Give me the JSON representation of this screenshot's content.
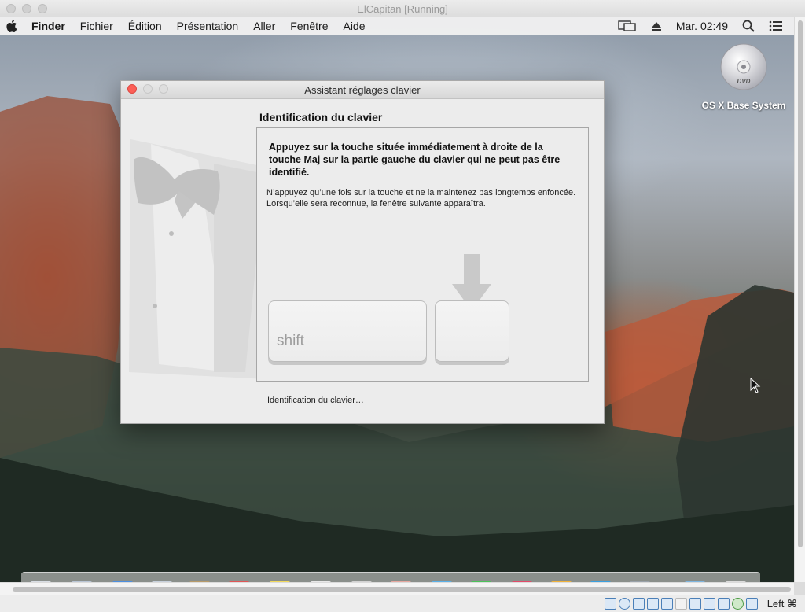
{
  "host_window": {
    "title": "ElCapitan [Running]",
    "host_key": "Left ⌘"
  },
  "menubar": {
    "app_name": "Finder",
    "items": [
      "Fichier",
      "Édition",
      "Présentation",
      "Aller",
      "Fenêtre",
      "Aide"
    ],
    "clock": "Mar. 02:49"
  },
  "desktop": {
    "volume_label": "OS X Base System",
    "dvd_text": "DVD"
  },
  "dialog": {
    "title": "Assistant réglages clavier",
    "heading": "Identification du clavier",
    "instruction_bold": "Appuyez sur la touche située immédiatement à droite de la touche Maj sur la partie gauche du clavier qui ne peut pas être identifié.",
    "instruction_normal": "N’appuyez qu’une fois sur la touche et ne la maintenez pas longtemps enfoncée. Lorsqu’elle sera reconnue, la fenêtre suivante apparaîtra.",
    "shift_label": "shift",
    "status": "Identification du clavier…"
  }
}
